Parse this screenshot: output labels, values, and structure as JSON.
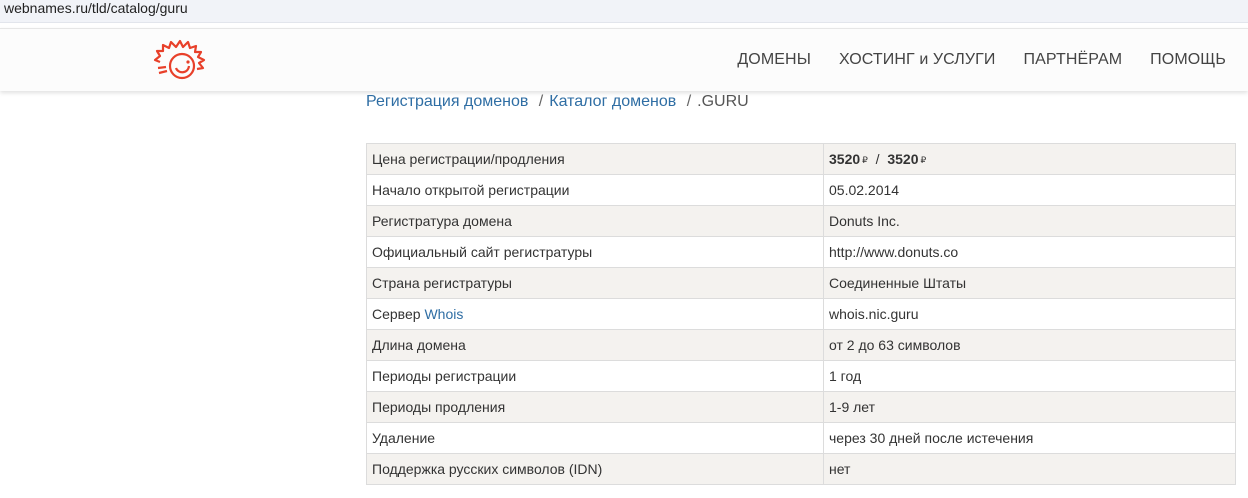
{
  "browser": {
    "url": "webnames.ru/tld/catalog/guru"
  },
  "colors": {
    "brand": "#e8402a",
    "link": "#2f6ea4"
  },
  "nav": {
    "logo_icon": "sun-logo-icon",
    "items": [
      "ДОМЕНЫ",
      "ХОСТИНГ и УСЛУГИ",
      "ПАРТНЁРАМ",
      "ПОМОЩЬ"
    ]
  },
  "breadcrumb": {
    "items": [
      "Регистрация доменов",
      "Каталог доменов",
      ".GURU"
    ],
    "separator": "/"
  },
  "table": {
    "price": {
      "label": "Цена регистрации/продления",
      "registration": "3520",
      "renewal": "3520",
      "divider": "/",
      "currency_icon": "ruble-icon"
    },
    "rows": [
      {
        "label": "Начало открытой регистрации",
        "value": "05.02.2014"
      },
      {
        "label": "Регистратура домена",
        "value": "Donuts Inc."
      },
      {
        "label": "Официальный сайт регистратуры",
        "value": "http://www.donuts.co"
      },
      {
        "label": "Страна регистратуры",
        "value": "Соединенные Штаты"
      }
    ],
    "whois": {
      "label": "Сервер",
      "link": "Whois",
      "value": "whois.nic.guru"
    },
    "rows2": [
      {
        "label": "Длина домена",
        "value": "от 2 до 63 символов"
      },
      {
        "label": "Периоды регистрации",
        "value": "1 год"
      },
      {
        "label": "Периоды продления",
        "value": "1-9 лет"
      },
      {
        "label": "Удаление",
        "value": "через 30 дней после истечения"
      },
      {
        "label": "Поддержка русских символов (IDN)",
        "value": "нет"
      }
    ]
  }
}
